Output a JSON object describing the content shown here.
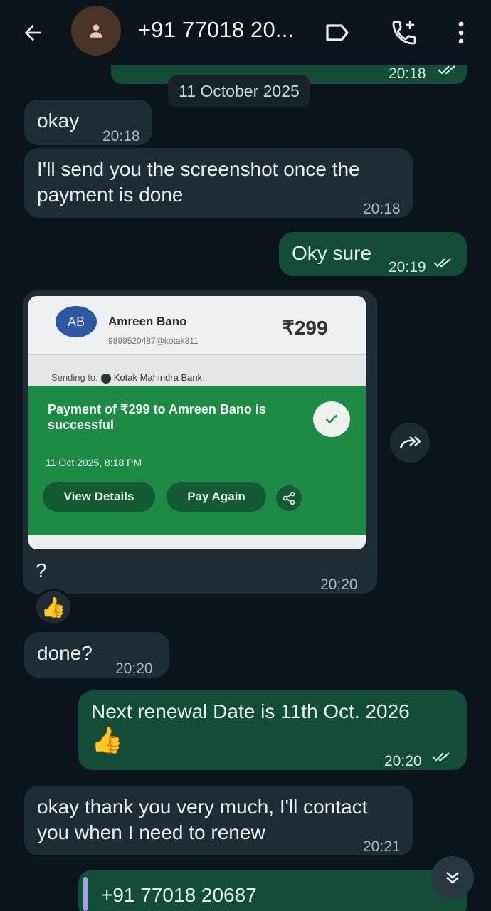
{
  "header": {
    "contact_name": "+91 77018 20...",
    "icons": [
      "back-arrow-icon",
      "avatar-icon",
      "label-icon",
      "add-call-icon",
      "more-vert-icon"
    ]
  },
  "date_chip": "11 October 2025",
  "top_partial_time": "20:18",
  "messages": [
    {
      "dir": "in",
      "text": "okay",
      "time": "20:18"
    },
    {
      "dir": "in",
      "text": "I'll send you the screenshot once the payment is done",
      "time": "20:18"
    },
    {
      "dir": "out",
      "text": "Oky sure",
      "time": "20:19"
    },
    {
      "dir": "in",
      "caption": "?",
      "time": "20:20",
      "reaction": "👍"
    },
    {
      "dir": "in",
      "text": "done?",
      "time": "20:20"
    },
    {
      "dir": "out",
      "text": "Next renewal Date is 11th Oct. 2026",
      "emoji": "👍",
      "time": "20:20"
    },
    {
      "dir": "in",
      "text": "okay thank you very much, I'll contact you when I need to renew",
      "time": "20:21"
    },
    {
      "dir": "out",
      "quoted": "+91 77018 20687"
    }
  ],
  "payment_screenshot": {
    "initials": "AB",
    "name": "Amreen Bano",
    "upi": "9899520487@kotak811",
    "amount": "₹299",
    "sending_label": "Sending to:",
    "bank": "Kotak Mahindra Bank",
    "status": "Payment of ₹299 to Amreen Bano is successful",
    "datetime": "11 Oct 2025, 8:18 PM",
    "view_details": "View Details",
    "pay_again": "Pay Again"
  },
  "colors": {
    "background": "#0b141a",
    "incoming": "#202c33",
    "outgoing": "#144d37",
    "payment_green": "#1d8a46"
  }
}
